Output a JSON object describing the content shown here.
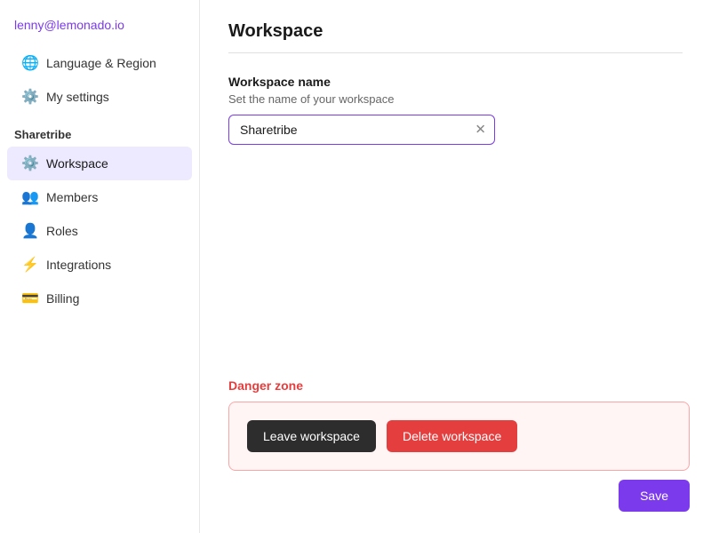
{
  "user": {
    "email": "lenny@lemonado.io"
  },
  "sidebar": {
    "section_label": "Sharetribe",
    "top_items": [
      {
        "id": "language-region",
        "label": "Language & Region",
        "icon": "🌐"
      },
      {
        "id": "my-settings",
        "label": "My settings",
        "icon": "⚙️"
      }
    ],
    "items": [
      {
        "id": "workspace",
        "label": "Workspace",
        "icon": "⚙️",
        "active": true
      },
      {
        "id": "members",
        "label": "Members",
        "icon": "👥"
      },
      {
        "id": "roles",
        "label": "Roles",
        "icon": "👤"
      },
      {
        "id": "integrations",
        "label": "Integrations",
        "icon": "⚡"
      },
      {
        "id": "billing",
        "label": "Billing",
        "icon": "💳"
      }
    ]
  },
  "main": {
    "title": "Workspace",
    "workspace_name_label": "Workspace name",
    "workspace_name_hint": "Set the name of your workspace",
    "workspace_name_value": "Sharetribe",
    "danger_zone_label": "Danger zone",
    "leave_workspace_label": "Leave workspace",
    "delete_workspace_label": "Delete workspace",
    "save_label": "Save"
  }
}
